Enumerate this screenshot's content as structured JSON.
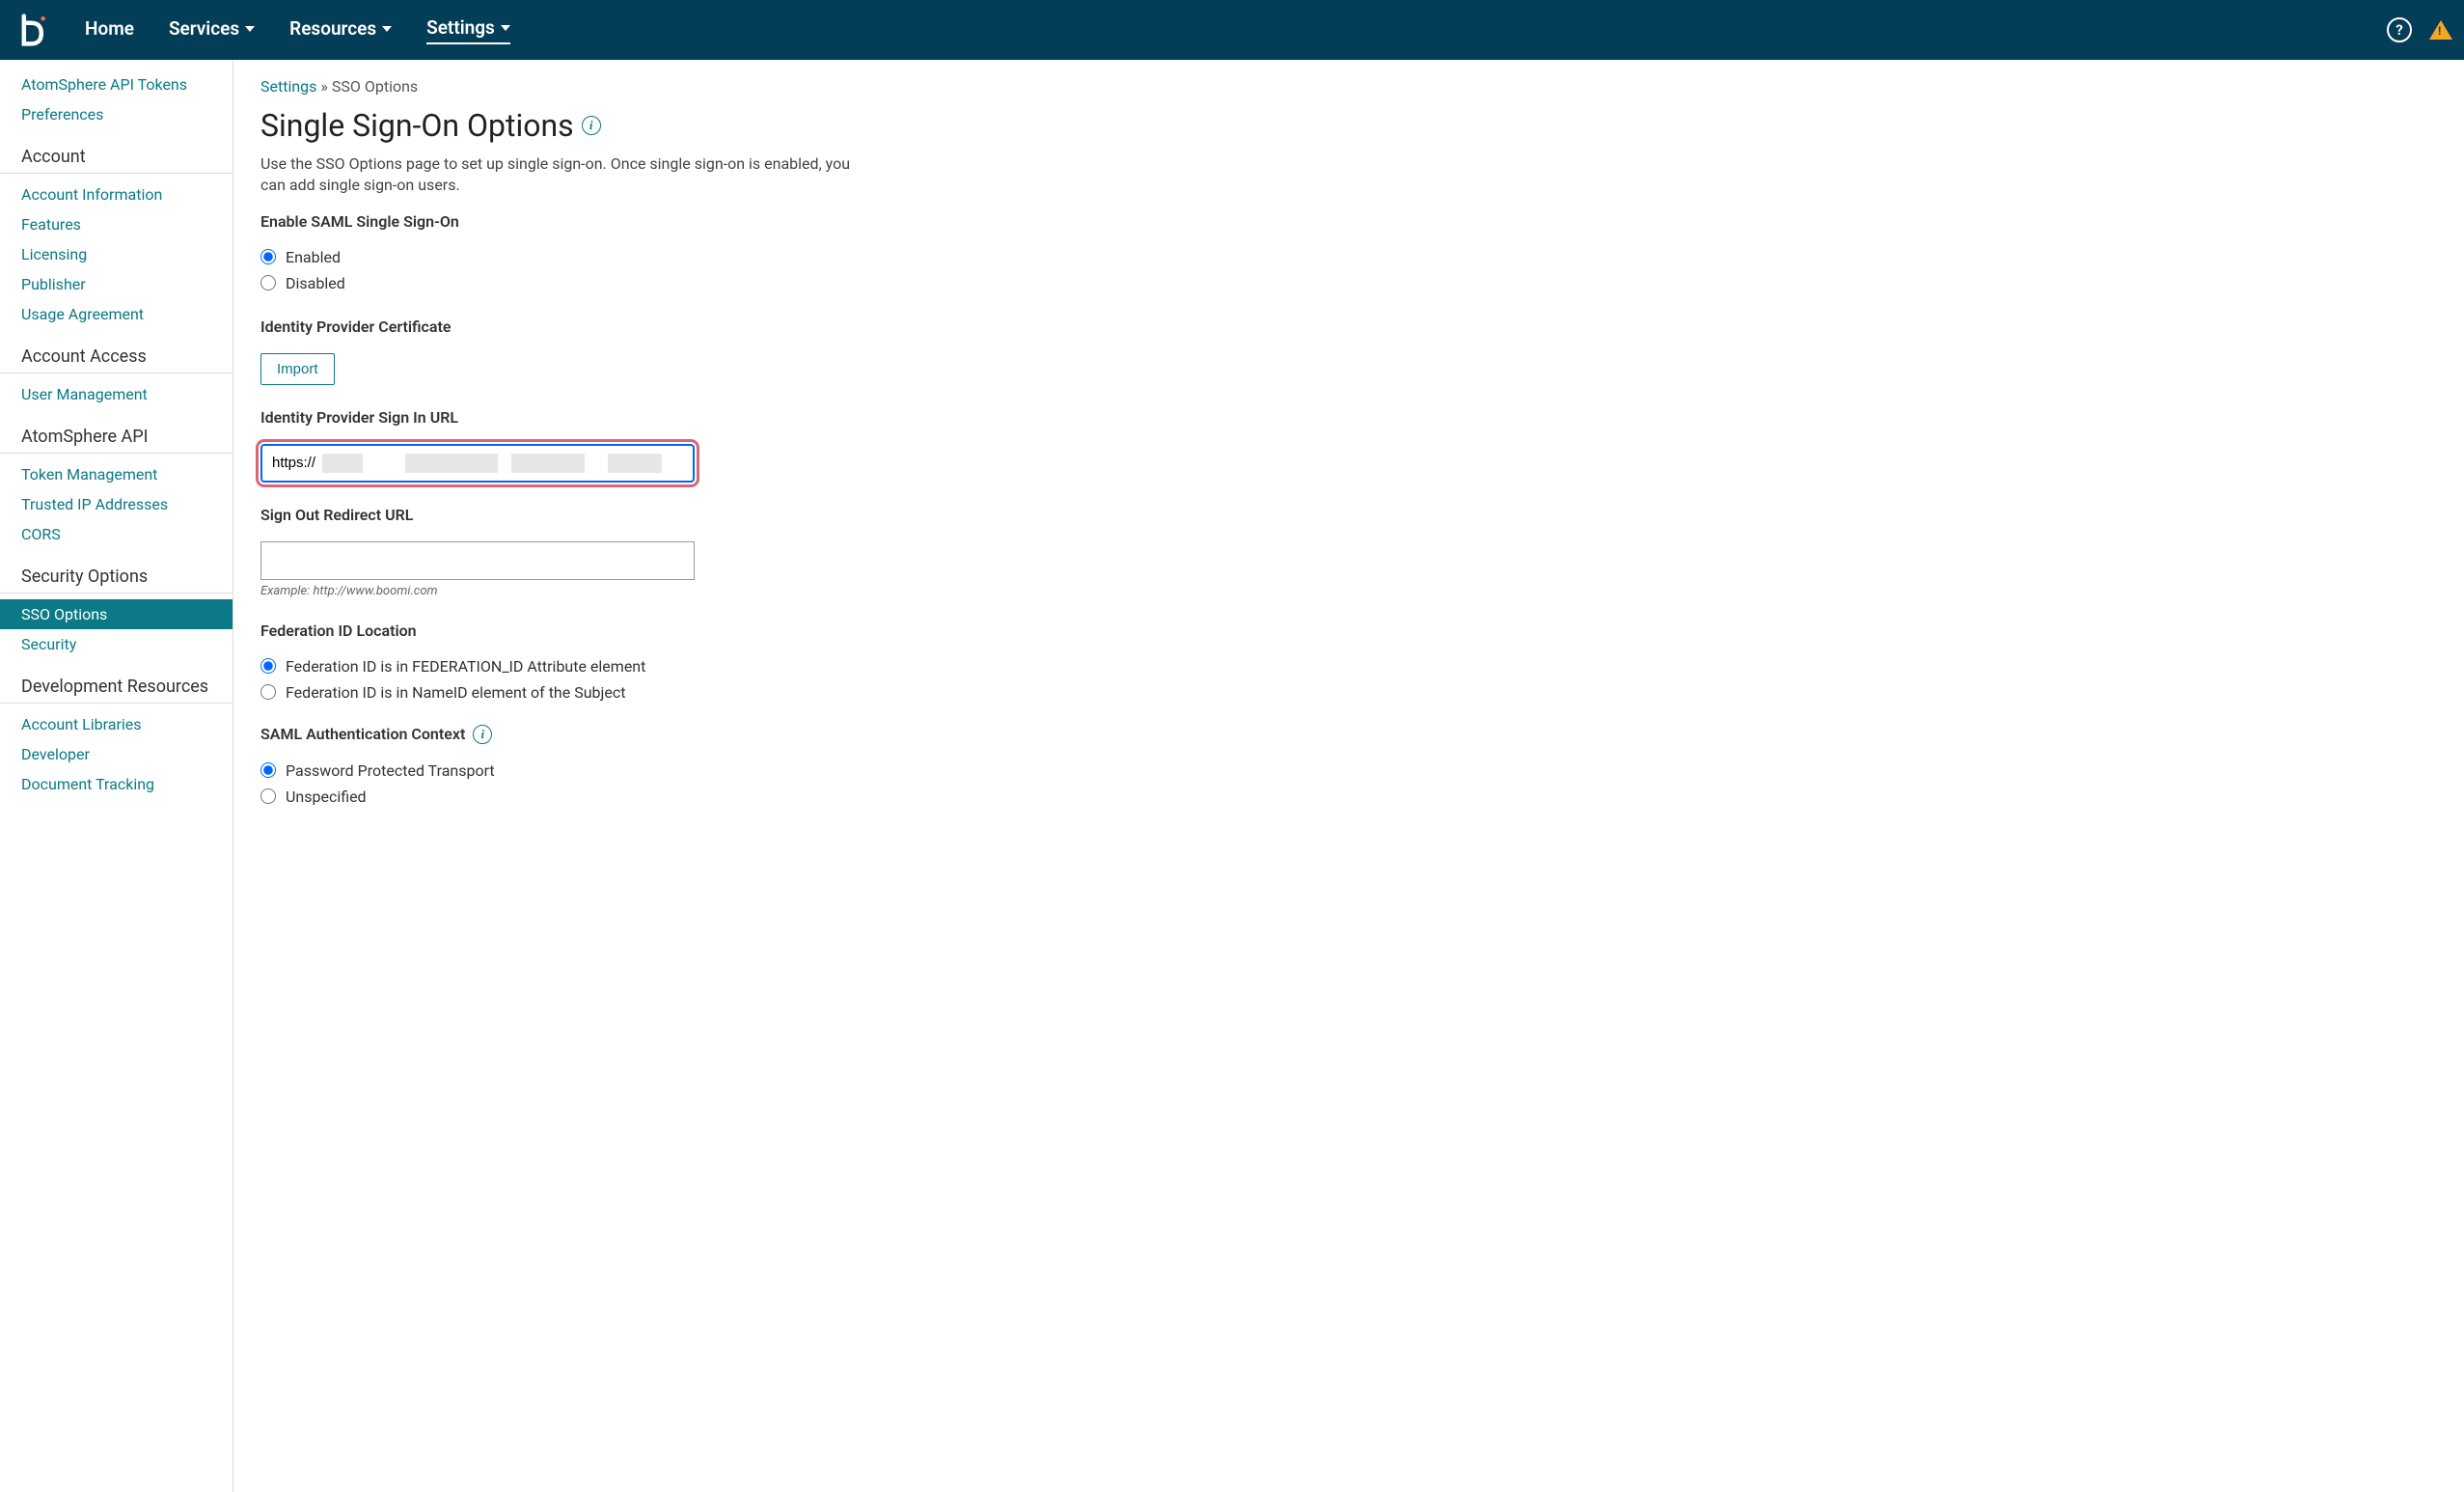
{
  "topnav": {
    "items": [
      "Home",
      "Services",
      "Resources",
      "Settings"
    ],
    "activeIndex": 3
  },
  "sidebar": {
    "topLinks": [
      "AtomSphere API Tokens",
      "Preferences"
    ],
    "groups": [
      {
        "heading": "Account",
        "links": [
          "Account Information",
          "Features",
          "Licensing",
          "Publisher",
          "Usage Agreement"
        ]
      },
      {
        "heading": "Account Access",
        "links": [
          "User Management"
        ]
      },
      {
        "heading": "AtomSphere API",
        "links": [
          "Token Management",
          "Trusted IP Addresses",
          "CORS"
        ]
      },
      {
        "heading": "Security Options",
        "links": [
          "SSO Options",
          "Security"
        ],
        "activeIndex": 0
      },
      {
        "heading": "Development Resources",
        "links": [
          "Account Libraries",
          "Developer",
          "Document Tracking"
        ]
      }
    ]
  },
  "breadcrumb": {
    "parent": "Settings",
    "sep": " » ",
    "current": "SSO Options"
  },
  "page": {
    "title": "Single Sign-On Options",
    "description": "Use the SSO Options page to set up single sign-on. Once single sign-on is enabled, you can add single sign-on users."
  },
  "form": {
    "enableSaml": {
      "label": "Enable SAML Single Sign-On",
      "options": [
        "Enabled",
        "Disabled"
      ],
      "selected": 0
    },
    "idpCert": {
      "label": "Identity Provider Certificate",
      "button": "Import"
    },
    "idpSignInUrl": {
      "label": "Identity Provider Sign In URL",
      "value": "https://"
    },
    "signOutUrl": {
      "label": "Sign Out Redirect URL",
      "value": "",
      "hint": "Example: http://www.boomi.com"
    },
    "federation": {
      "label": "Federation ID Location",
      "options": [
        "Federation ID is in FEDERATION_ID Attribute element",
        "Federation ID is in NameID element of the Subject"
      ],
      "selected": 0
    },
    "samlAuth": {
      "label": "SAML Authentication Context",
      "options": [
        "Password Protected Transport",
        "Unspecified"
      ],
      "selected": 0
    }
  }
}
